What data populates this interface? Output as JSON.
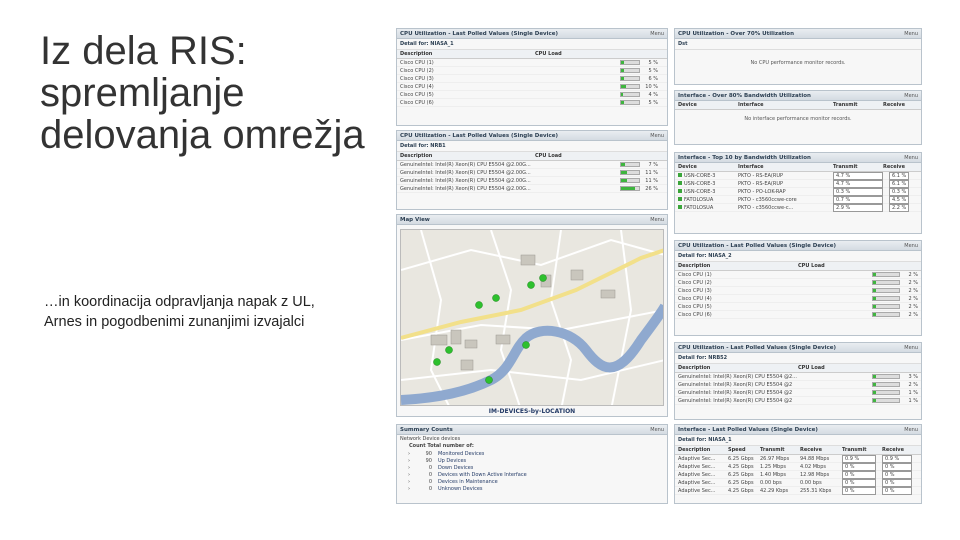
{
  "slide": {
    "title_lines": [
      "Iz dela RIS:",
      "spremljanje",
      "delovanja omrežja"
    ],
    "body": "…in koordinacija odpravljanja napak z UL, Arnes in pogodbenimi zunanjimi izvajalci"
  },
  "menu_label": "Menu",
  "cpu1": {
    "title": "CPU Utilization - Last Polled Values (Single Device)",
    "detail": "Detail for: NIASA_1",
    "col_desc": "Description",
    "col_load": "CPU Load",
    "rows": [
      {
        "desc": "Cisco CPU (1)",
        "pct": "5 %",
        "fill": 0.05
      },
      {
        "desc": "Cisco CPU (2)",
        "pct": "5 %",
        "fill": 0.05
      },
      {
        "desc": "Cisco CPU (3)",
        "pct": "6 %",
        "fill": 0.06
      },
      {
        "desc": "Cisco CPU (4)",
        "pct": "10 %",
        "fill": 0.1
      },
      {
        "desc": "Cisco CPU (5)",
        "pct": "4 %",
        "fill": 0.04
      },
      {
        "desc": "Cisco CPU (6)",
        "pct": "5 %",
        "fill": 0.05
      }
    ]
  },
  "over70": {
    "title": "CPU Utilization - Over 70% Utilization",
    "col": "Dst",
    "empty": "No CPU performance monitor records."
  },
  "bw80": {
    "title": "Interface - Over 80% Bandwidth Utilization",
    "cols": [
      "Device",
      "Interface",
      "Transmit",
      "Receive"
    ],
    "empty": "No interface performance monitor records."
  },
  "cpu2": {
    "title": "CPU Utilization - Last Polled Values (Single Device)",
    "detail": "Detail for: NRB1",
    "col_desc": "Description",
    "col_load": "CPU Load",
    "rows": [
      {
        "desc": "GenuineIntel: Intel(R) Xeon(R) CPU E5504 @2.00G...",
        "pct": "7 %",
        "fill": 0.07
      },
      {
        "desc": "GenuineIntel: Intel(R) Xeon(R) CPU E5504 @2.00G...",
        "pct": "11 %",
        "fill": 0.11
      },
      {
        "desc": "GenuineIntel: Intel(R) Xeon(R) CPU E5504 @2.00G...",
        "pct": "11 %",
        "fill": 0.11
      },
      {
        "desc": "GenuineIntel: Intel(R) Xeon(R) CPU E5504 @2.00G...",
        "pct": "26 %",
        "fill": 0.26
      }
    ]
  },
  "top10": {
    "title": "Interface - Top 10 by Bandwidth Utilization",
    "cols": [
      "Device",
      "Interface",
      "Transmit",
      "Receive"
    ],
    "rows": [
      {
        "device": "USN-CORE-3",
        "iface": "PKTO - RS-EA(RUP",
        "tx": "4.7 %",
        "rx": "6.1 %"
      },
      {
        "device": "USN-CORE-3",
        "iface": "PKTO - RS-EA(RUP",
        "tx": "4.7 %",
        "rx": "6.1 %"
      },
      {
        "device": "USN-CORE-3",
        "iface": "PKTO - PO-LOK-RAP",
        "tx": "0.3 %",
        "rx": "0.3 %"
      },
      {
        "device": "FATOLOSUA",
        "iface": "PKTO - c3560ccwe-core",
        "tx": "0.7 %",
        "rx": "4.5 %"
      },
      {
        "device": "FATOLOSUA",
        "iface": "PKTO - c3560ccwe-c...",
        "tx": "2.9 %",
        "rx": "2.2 %"
      }
    ]
  },
  "map": {
    "title": "Map View",
    "caption": "IM-DEVICES-by-LOCATION"
  },
  "cpu3": {
    "title": "CPU Utilization - Last Polled Values (Single Device)",
    "detail": "Detail for: NIASA_2",
    "col_desc": "Description",
    "col_load": "CPU Load",
    "rows": [
      {
        "desc": "Cisco CPU (1)",
        "pct": "2 %",
        "fill": 0.02
      },
      {
        "desc": "Cisco CPU (2)",
        "pct": "2 %",
        "fill": 0.02
      },
      {
        "desc": "Cisco CPU (3)",
        "pct": "2 %",
        "fill": 0.02
      },
      {
        "desc": "Cisco CPU (4)",
        "pct": "2 %",
        "fill": 0.02
      },
      {
        "desc": "Cisco CPU (5)",
        "pct": "2 %",
        "fill": 0.02
      },
      {
        "desc": "Cisco CPU (6)",
        "pct": "2 %",
        "fill": 0.02
      }
    ]
  },
  "cpu4": {
    "title": "CPU Utilization - Last Polled Values (Single Device)",
    "detail": "Detail for: NRB52",
    "col_desc": "Description",
    "col_load": "CPU Load",
    "rows": [
      {
        "desc": "GenuineIntel: Intel(R) Xeon(R) CPU E5504 @2...",
        "pct": "3 %",
        "fill": 0.03
      },
      {
        "desc": "GenuineIntel: Intel(R) Xeon(R) CPU E5504 @2",
        "pct": "2 %",
        "fill": 0.02
      },
      {
        "desc": "GenuineIntel: Intel(R) Xeon(R) CPU E5504 @2",
        "pct": "1 %",
        "fill": 0.01
      },
      {
        "desc": "GenuineIntel: Intel(R) Xeon(R) CPU E5504 @2",
        "pct": "1 %",
        "fill": 0.01
      }
    ]
  },
  "summary": {
    "title": "Summary Counts",
    "line1": "Network Device devices",
    "line2": "Count  Total number of:",
    "rows": [
      {
        "count": "90",
        "label": "Monitored Devices"
      },
      {
        "count": "90",
        "label": "Up Devices"
      },
      {
        "count": "0",
        "label": "Down Devices"
      },
      {
        "count": "0",
        "label": "Devices with Down Active Interface"
      },
      {
        "count": "0",
        "label": "Devices in Maintenance"
      },
      {
        "count": "0",
        "label": "Unknown Devices"
      }
    ]
  },
  "iface": {
    "title": "Interface - Last Polled Values (Single Device)",
    "detail": "Detail for: NIASA_1",
    "cols": [
      "Description",
      "Speed",
      "Transmit",
      "Receive",
      "Transmit",
      "Receive"
    ],
    "rows": [
      {
        "desc": "Adaptive Sec...",
        "speed": "6.25 Gbps",
        "tx": "26.97 Mbps",
        "rx": "94.88 Mbps",
        "txp": "0.9 %",
        "rxp": "0.9 %"
      },
      {
        "desc": "Adaptive Sec...",
        "speed": "4.25 Gbps",
        "tx": "1.25 Mbps",
        "rx": "4.02 Mbps",
        "txp": "0 %",
        "rxp": "0 %"
      },
      {
        "desc": "Adaptive Sec...",
        "speed": "6.25 Gbps",
        "tx": "1.40 Mbps",
        "rx": "12.98 Mbps",
        "txp": "0 %",
        "rxp": "0 %"
      },
      {
        "desc": "Adaptive Sec...",
        "speed": "6.25 Gbps",
        "tx": "0.00 bps",
        "rx": "0.00 bps",
        "txp": "0 %",
        "rxp": "0 %"
      },
      {
        "desc": "Adaptive Sec...",
        "speed": "4.25 Gbps",
        "tx": "42.29 Kbps",
        "rx": "255.31 Kbps",
        "txp": "0 %",
        "rxp": "0 %"
      }
    ]
  },
  "colors": {
    "bar_fill": "#3fb53f",
    "river": "#8fa9cf",
    "header": "#2c3f52"
  }
}
